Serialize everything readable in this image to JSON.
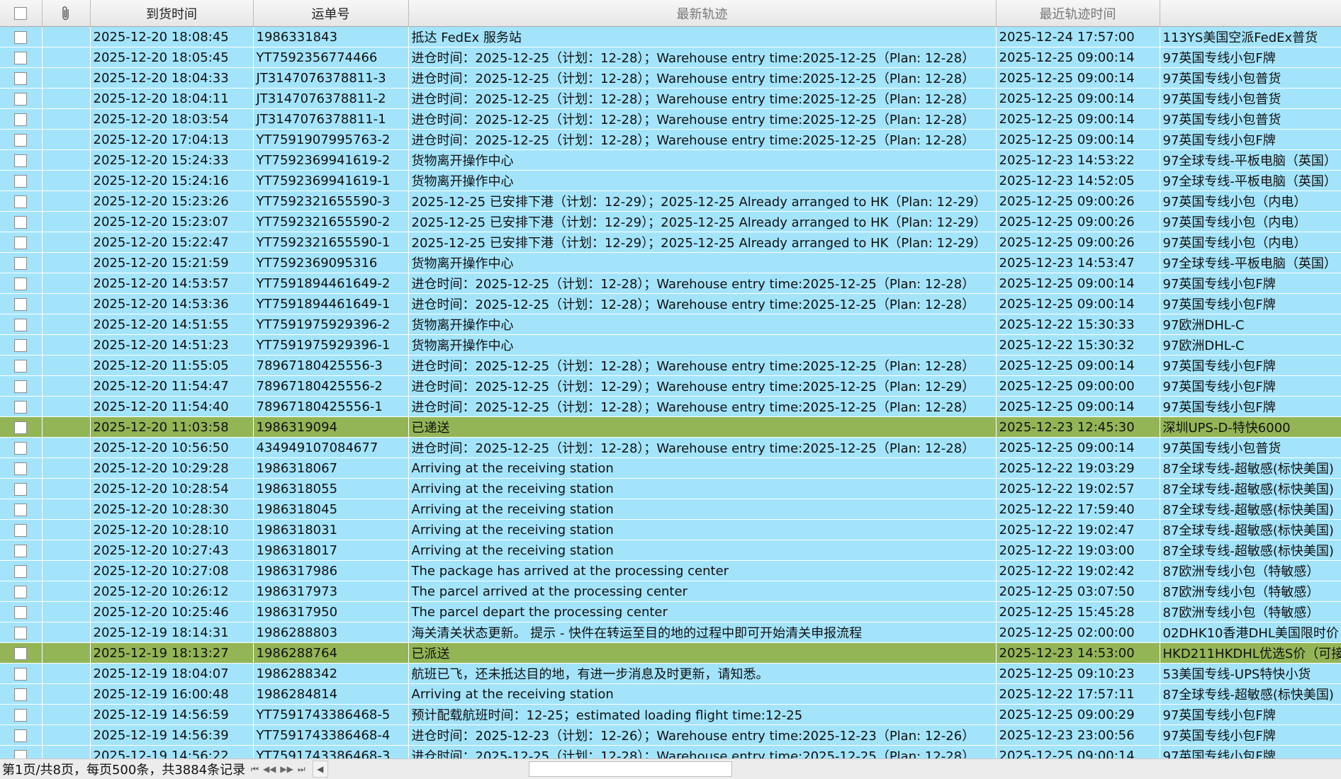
{
  "columns": {
    "arrival_time": "到货时间",
    "waybill_no": "运单号",
    "latest_track": "最新轨迹",
    "latest_track_time": "最近轨迹时间"
  },
  "colors": {
    "row_default": "#a3e4fb",
    "row_delivered": "#93b556"
  },
  "rows": [
    {
      "arrival_time": "2025-12-20 18:08:45",
      "waybill_no": "1986331843",
      "latest_track": "抵达 FedEx 服务站",
      "latest_track_time": "2025-12-24 17:57:00",
      "channel": "113YS美国空派FedEx普货",
      "delivered": false
    },
    {
      "arrival_time": "2025-12-20 18:05:45",
      "waybill_no": "YT7592356774466",
      "latest_track": "进仓时间：2025-12-25（计划：12-28）；Warehouse entry time:2025-12-25（Plan: 12-28）",
      "latest_track_time": "2025-12-25 09:00:14",
      "channel": "97英国专线小包F牌",
      "delivered": false
    },
    {
      "arrival_time": "2025-12-20 18:04:33",
      "waybill_no": "JT3147076378811-3",
      "latest_track": "进仓时间：2025-12-25（计划：12-28）；Warehouse entry time:2025-12-25（Plan: 12-28）",
      "latest_track_time": "2025-12-25 09:00:14",
      "channel": "97英国专线小包普货",
      "delivered": false
    },
    {
      "arrival_time": "2025-12-20 18:04:11",
      "waybill_no": "JT3147076378811-2",
      "latest_track": "进仓时间：2025-12-25（计划：12-28）；Warehouse entry time:2025-12-25（Plan: 12-28）",
      "latest_track_time": "2025-12-25 09:00:14",
      "channel": "97英国专线小包普货",
      "delivered": false
    },
    {
      "arrival_time": "2025-12-20 18:03:54",
      "waybill_no": "JT3147076378811-1",
      "latest_track": "进仓时间：2025-12-25（计划：12-28）；Warehouse entry time:2025-12-25（Plan: 12-28）",
      "latest_track_time": "2025-12-25 09:00:14",
      "channel": "97英国专线小包普货",
      "delivered": false
    },
    {
      "arrival_time": "2025-12-20 17:04:13",
      "waybill_no": "YT7591907995763-2",
      "latest_track": "进仓时间：2025-12-25（计划：12-28）；Warehouse entry time:2025-12-25（Plan: 12-28）",
      "latest_track_time": "2025-12-25 09:00:14",
      "channel": "97英国专线小包F牌",
      "delivered": false
    },
    {
      "arrival_time": "2025-12-20 15:24:33",
      "waybill_no": "YT7592369941619-2",
      "latest_track": "货物离开操作中心",
      "latest_track_time": "2025-12-23 14:53:22",
      "channel": "97全球专线-平板电脑（英国）",
      "delivered": false
    },
    {
      "arrival_time": "2025-12-20 15:24:16",
      "waybill_no": "YT7592369941619-1",
      "latest_track": "货物离开操作中心",
      "latest_track_time": "2025-12-23 14:52:05",
      "channel": "97全球专线-平板电脑（英国）",
      "delivered": false
    },
    {
      "arrival_time": "2025-12-20 15:23:26",
      "waybill_no": "YT7592321655590-3",
      "latest_track": "2025-12-25 已安排下港（计划：12-29）；2025-12-25 Already arranged  to HK（Plan: 12-29）",
      "latest_track_time": "2025-12-25 09:00:26",
      "channel": "97英国专线小包（内电）",
      "delivered": false
    },
    {
      "arrival_time": "2025-12-20 15:23:07",
      "waybill_no": "YT7592321655590-2",
      "latest_track": "2025-12-25 已安排下港（计划：12-29）；2025-12-25 Already arranged  to HK（Plan: 12-29）",
      "latest_track_time": "2025-12-25 09:00:26",
      "channel": "97英国专线小包（内电）",
      "delivered": false
    },
    {
      "arrival_time": "2025-12-20 15:22:47",
      "waybill_no": "YT7592321655590-1",
      "latest_track": "2025-12-25 已安排下港（计划：12-29）；2025-12-25 Already arranged  to HK（Plan: 12-29）",
      "latest_track_time": "2025-12-25 09:00:26",
      "channel": "97英国专线小包（内电）",
      "delivered": false
    },
    {
      "arrival_time": "2025-12-20 15:21:59",
      "waybill_no": "YT7592369095316",
      "latest_track": "货物离开操作中心",
      "latest_track_time": "2025-12-23 14:53:47",
      "channel": "97全球专线-平板电脑（英国）",
      "delivered": false
    },
    {
      "arrival_time": "2025-12-20 14:53:57",
      "waybill_no": "YT7591894461649-2",
      "latest_track": "进仓时间：2025-12-25（计划：12-28）；Warehouse entry time:2025-12-25（Plan: 12-28）",
      "latest_track_time": "2025-12-25 09:00:14",
      "channel": "97英国专线小包F牌",
      "delivered": false
    },
    {
      "arrival_time": "2025-12-20 14:53:36",
      "waybill_no": "YT7591894461649-1",
      "latest_track": "进仓时间：2025-12-25（计划：12-28）；Warehouse entry time:2025-12-25（Plan: 12-28）",
      "latest_track_time": "2025-12-25 09:00:14",
      "channel": "97英国专线小包F牌",
      "delivered": false
    },
    {
      "arrival_time": "2025-12-20 14:51:55",
      "waybill_no": "YT7591975929396-2",
      "latest_track": "货物离开操作中心",
      "latest_track_time": "2025-12-22 15:30:33",
      "channel": "97欧洲DHL-C",
      "delivered": false
    },
    {
      "arrival_time": "2025-12-20 14:51:23",
      "waybill_no": "YT7591975929396-1",
      "latest_track": "货物离开操作中心",
      "latest_track_time": "2025-12-22 15:30:32",
      "channel": "97欧洲DHL-C",
      "delivered": false
    },
    {
      "arrival_time": "2025-12-20 11:55:05",
      "waybill_no": "78967180425556-3",
      "latest_track": "进仓时间：2025-12-25（计划：12-28）；Warehouse entry time:2025-12-25（Plan: 12-28）",
      "latest_track_time": "2025-12-25 09:00:14",
      "channel": "97英国专线小包F牌",
      "delivered": false
    },
    {
      "arrival_time": "2025-12-20 11:54:47",
      "waybill_no": "78967180425556-2",
      "latest_track": "进仓时间：2025-12-25（计划：12-29）；Warehouse entry time:2025-12-25（Plan: 12-29）",
      "latest_track_time": "2025-12-25 09:00:00",
      "channel": "97英国专线小包F牌",
      "delivered": false
    },
    {
      "arrival_time": "2025-12-20 11:54:40",
      "waybill_no": "78967180425556-1",
      "latest_track": "进仓时间：2025-12-25（计划：12-28）；Warehouse entry time:2025-12-25（Plan: 12-28）",
      "latest_track_time": "2025-12-25 09:00:14",
      "channel": "97英国专线小包F牌",
      "delivered": false
    },
    {
      "arrival_time": "2025-12-20 11:03:58",
      "waybill_no": "1986319094",
      "latest_track": "已递送",
      "latest_track_time": "2025-12-23 12:45:30",
      "channel": "深圳UPS-D-特快6000",
      "delivered": true
    },
    {
      "arrival_time": "2025-12-20 10:56:50",
      "waybill_no": "434949107084677",
      "latest_track": "进仓时间：2025-12-25（计划：12-28）；Warehouse entry time:2025-12-25（Plan: 12-28）",
      "latest_track_time": "2025-12-25 09:00:14",
      "channel": "97英国专线小包普货",
      "delivered": false
    },
    {
      "arrival_time": "2025-12-20 10:29:28",
      "waybill_no": "1986318067",
      "latest_track": "Arriving at the receiving station",
      "latest_track_time": "2025-12-22 19:03:29",
      "channel": "87全球专线-超敏感(标快美国)",
      "delivered": false
    },
    {
      "arrival_time": "2025-12-20 10:28:54",
      "waybill_no": "1986318055",
      "latest_track": "Arriving at the receiving station",
      "latest_track_time": "2025-12-22 19:02:57",
      "channel": "87全球专线-超敏感(标快美国)",
      "delivered": false
    },
    {
      "arrival_time": "2025-12-20 10:28:30",
      "waybill_no": "1986318045",
      "latest_track": "Arriving at the receiving station",
      "latest_track_time": "2025-12-22 17:59:40",
      "channel": "87全球专线-超敏感(标快美国)",
      "delivered": false
    },
    {
      "arrival_time": "2025-12-20 10:28:10",
      "waybill_no": "1986318031",
      "latest_track": "Arriving at the receiving station",
      "latest_track_time": "2025-12-22 19:02:47",
      "channel": "87全球专线-超敏感(标快美国)",
      "delivered": false
    },
    {
      "arrival_time": "2025-12-20 10:27:43",
      "waybill_no": "1986318017",
      "latest_track": "Arriving at the receiving station",
      "latest_track_time": "2025-12-22 19:03:00",
      "channel": "87全球专线-超敏感(标快美国)",
      "delivered": false
    },
    {
      "arrival_time": "2025-12-20 10:27:08",
      "waybill_no": "1986317986",
      "latest_track": "The package has arrived at the processing center",
      "latest_track_time": "2025-12-22 19:02:42",
      "channel": "87欧洲专线小包（特敏感）",
      "delivered": false
    },
    {
      "arrival_time": "2025-12-20 10:26:12",
      "waybill_no": "1986317973",
      "latest_track": "The parcel arrived at the processing center",
      "latest_track_time": "2025-12-25 03:07:50",
      "channel": "87欧洲专线小包（特敏感）",
      "delivered": false
    },
    {
      "arrival_time": "2025-12-20 10:25:46",
      "waybill_no": "1986317950",
      "latest_track": "The parcel depart the processing center",
      "latest_track_time": "2025-12-25 15:45:28",
      "channel": "87欧洲专线小包（特敏感）",
      "delivered": false
    },
    {
      "arrival_time": "2025-12-19 18:14:31",
      "waybill_no": "1986288803",
      "latest_track": "海关清关状态更新。 提示 - 快件在转运至目的地的过程中即可开始清关申报流程",
      "latest_track_time": "2025-12-25 02:00:00",
      "channel": "02DHK10香港DHL美国限时价",
      "delivered": false
    },
    {
      "arrival_time": "2025-12-19 18:13:27",
      "waybill_no": "1986288764",
      "latest_track": "已派送",
      "latest_track_time": "2025-12-23 14:53:00",
      "channel": "HKD211HKDHL优选S价（可接",
      "delivered": true
    },
    {
      "arrival_time": "2025-12-19 18:04:07",
      "waybill_no": "1986288342",
      "latest_track": "航班已飞，还未抵达目的地，有进一步消息及时更新，请知悉。",
      "latest_track_time": "2025-12-25 09:10:23",
      "channel": "53美国专线-UPS特快小货",
      "delivered": false
    },
    {
      "arrival_time": "2025-12-19 16:00:48",
      "waybill_no": "1986284814",
      "latest_track": "Arriving at the receiving station",
      "latest_track_time": "2025-12-22 17:57:11",
      "channel": "87全球专线-超敏感(标快美国)",
      "delivered": false
    },
    {
      "arrival_time": "2025-12-19 14:56:59",
      "waybill_no": "YT7591743386468-5",
      "latest_track": "预计配载航班时间：12-25；estimated loading flight time:12-25",
      "latest_track_time": "2025-12-25 09:00:29",
      "channel": "97英国专线小包F牌",
      "delivered": false
    },
    {
      "arrival_time": "2025-12-19 14:56:39",
      "waybill_no": "YT7591743386468-4",
      "latest_track": "进仓时间：2025-12-23（计划：12-26）；Warehouse entry time:2025-12-23（Plan: 12-26）",
      "latest_track_time": "2025-12-23 23:00:56",
      "channel": "97英国专线小包F牌",
      "delivered": false
    },
    {
      "arrival_time": "2025-12-19 14:56:22",
      "waybill_no": "YT7591743386468-3",
      "latest_track": "进仓时间：2025-12-25（计划：12-28）；Warehouse entry time:2025-12-25（Plan: 12-28）",
      "latest_track_time": "2025-12-25 09:00:14",
      "channel": "97英国专线小包F牌",
      "delivered": false
    }
  ],
  "status": {
    "page_info": "第1页/共8页，每页500条，共3884条记录"
  },
  "icons": {
    "attachment_header": "paperclip-icon",
    "pager_first": "first-page-icon",
    "pager_prev": "prev-page-icon",
    "pager_next": "next-page-icon",
    "pager_last": "last-page-icon",
    "scroll_left": "scroll-left-icon"
  }
}
